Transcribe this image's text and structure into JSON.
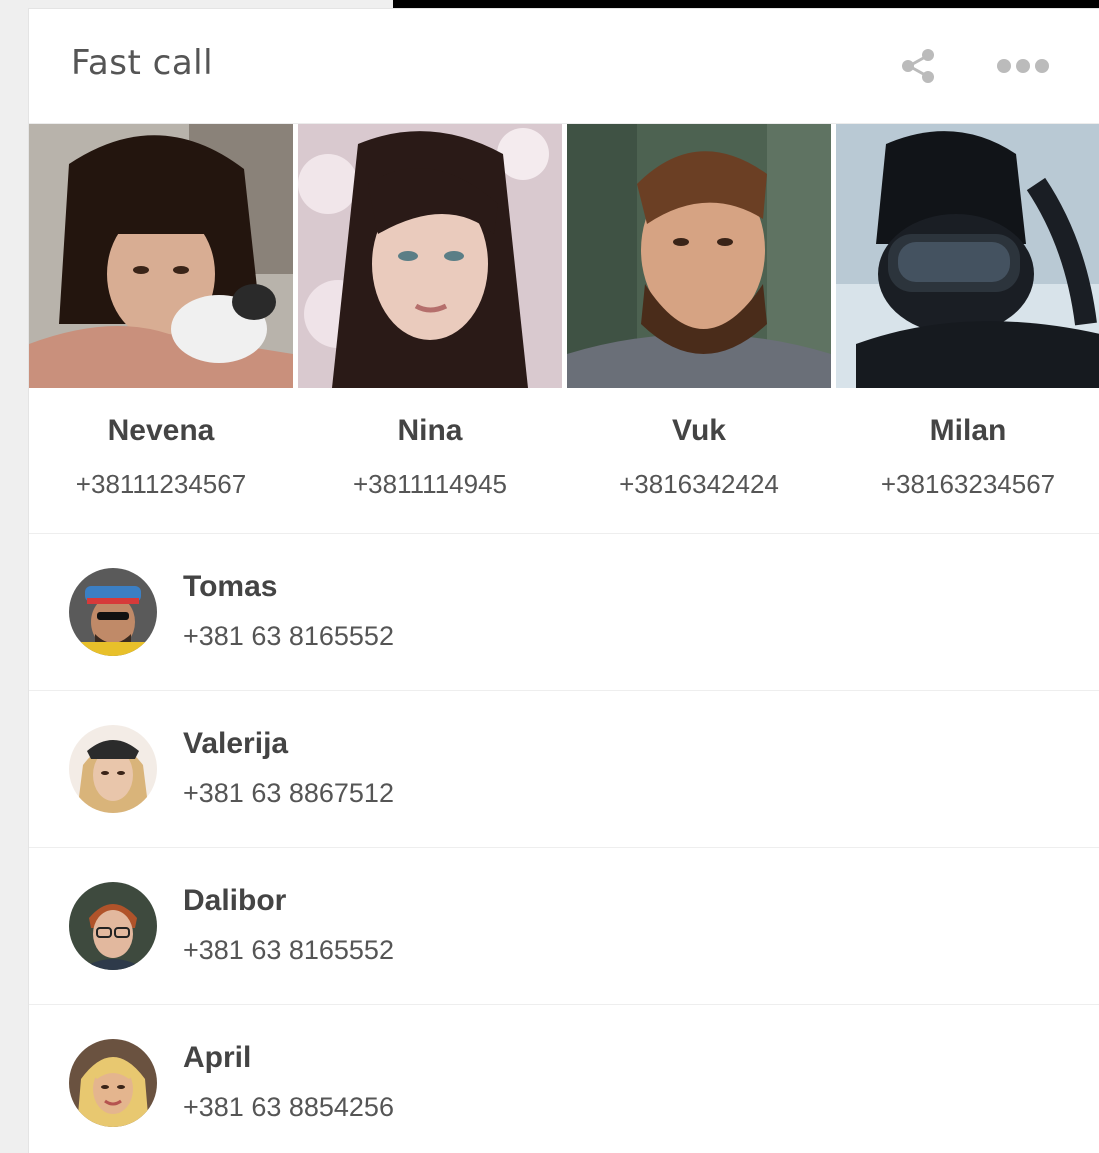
{
  "card": {
    "title": "Fast call",
    "share_icon": "share-icon",
    "more_icon": "more-horizontal-icon"
  },
  "featured": [
    {
      "name": "Nevena",
      "phone": "+38111234567"
    },
    {
      "name": "Nina",
      "phone": "+3811114945"
    },
    {
      "name": "Vuk",
      "phone": "+3816342424"
    },
    {
      "name": "Milan",
      "phone": "+38163234567"
    }
  ],
  "contacts": [
    {
      "name": "Tomas",
      "phone": "+381 63 8165552"
    },
    {
      "name": "Valerija",
      "phone": "+381 63 8867512"
    },
    {
      "name": "Dalibor",
      "phone": "+381 63 8165552"
    },
    {
      "name": "April",
      "phone": "+381 63 8854256"
    }
  ]
}
